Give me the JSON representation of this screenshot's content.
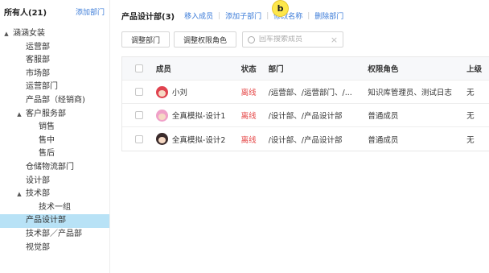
{
  "sidebar": {
    "title": "所有人(21)",
    "add_dept_label": "添加部门",
    "tree": [
      {
        "label": "涵涵女装",
        "indent": 0,
        "caret": "▲"
      },
      {
        "label": "运营部",
        "indent": 1
      },
      {
        "label": "客服部",
        "indent": 1
      },
      {
        "label": "市场部",
        "indent": 1
      },
      {
        "label": "运营部门",
        "indent": 1
      },
      {
        "label": "产品部（经销商)",
        "indent": 1
      },
      {
        "label": "客户服务部",
        "indent": 1,
        "caret": "▲"
      },
      {
        "label": "销售",
        "indent": 2
      },
      {
        "label": "售中",
        "indent": 2
      },
      {
        "label": "售后",
        "indent": 2
      },
      {
        "label": "仓储物流部门",
        "indent": 1
      },
      {
        "label": "设计部",
        "indent": 1
      },
      {
        "label": "技术部",
        "indent": 1,
        "caret": "▲"
      },
      {
        "label": "技术一组",
        "indent": 2
      },
      {
        "label": "产品设计部",
        "indent": 1,
        "selected": true
      },
      {
        "label": "技术部／产品部",
        "indent": 1
      },
      {
        "label": "视觉部",
        "indent": 1
      }
    ]
  },
  "header": {
    "title": "产品设计部(3)",
    "badge": "b",
    "actions": [
      "移入成员",
      "添加子部门",
      "修改名称",
      "删除部门"
    ]
  },
  "toolbar": {
    "adjust_dept_label": "调整部门",
    "adjust_role_label": "调整权限角色",
    "search_placeholder": "回车搜索成员",
    "clear_icon": "×"
  },
  "table": {
    "columns": [
      "成员",
      "状态",
      "部门",
      "权限角色",
      "上级"
    ],
    "rows": [
      {
        "name": "小刘",
        "status": "离线",
        "dept": "/运营部、/运营部门、/...",
        "role": "知识库管理员、测试日志",
        "sup": "无",
        "avatar": "av1"
      },
      {
        "name": "全真模拟-设计1",
        "status": "离线",
        "dept": "/设计部、/产品设计部",
        "role": "普通成员",
        "sup": "无",
        "avatar": "av2"
      },
      {
        "name": "全真模拟-设计2",
        "status": "离线",
        "dept": "/设计部、/产品设计部",
        "role": "普通成员",
        "sup": "无",
        "avatar": "av3"
      }
    ]
  },
  "colors": {
    "link": "#3b7bd8",
    "selected_bg": "#b8e2f6",
    "offline": "#e54848",
    "badge": "#fde74c"
  }
}
